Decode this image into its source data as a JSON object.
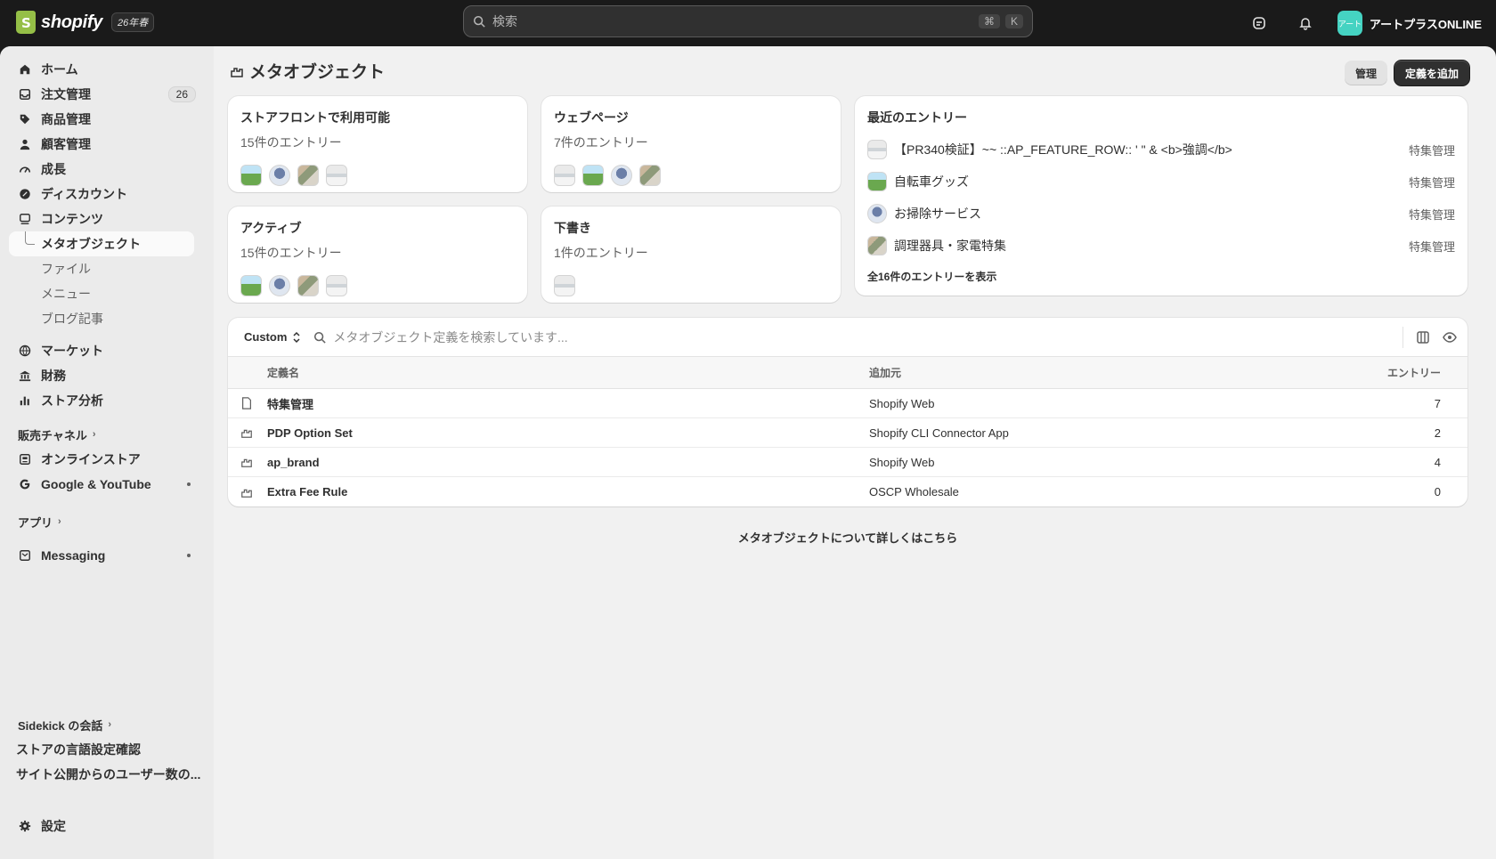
{
  "topbar": {
    "brand": "shopify",
    "edition_badge": "26年春",
    "search_placeholder": "検索",
    "shortcut_cmd": "⌘",
    "shortcut_key": "K",
    "store_avatar_text": "アート",
    "store_name": "アートプラスONLINE",
    "colors": {
      "background": "#1a1a1a",
      "avatar": "#45d3c2"
    }
  },
  "sidebar": {
    "items": [
      {
        "label": "ホーム",
        "icon": "home-icon"
      },
      {
        "label": "注文管理",
        "icon": "inbox-icon",
        "count": "26"
      },
      {
        "label": "商品管理",
        "icon": "tag-icon"
      },
      {
        "label": "顧客管理",
        "icon": "person-icon"
      },
      {
        "label": "成長",
        "icon": "gauge-icon"
      },
      {
        "label": "ディスカウント",
        "icon": "discount-icon"
      },
      {
        "label": "コンテンツ",
        "icon": "content-icon"
      }
    ],
    "content_sub": [
      {
        "label": "メタオブジェクト",
        "active": true
      },
      {
        "label": "ファイル"
      },
      {
        "label": "メニュー"
      },
      {
        "label": "ブログ記事"
      }
    ],
    "items2": [
      {
        "label": "マーケット",
        "icon": "globe-icon"
      },
      {
        "label": "財務",
        "icon": "bank-icon"
      },
      {
        "label": "ストア分析",
        "icon": "bar-chart-icon"
      }
    ],
    "sales_channels_label": "販売チャネル",
    "channels": [
      {
        "label": "オンラインストア",
        "icon": "store-icon"
      },
      {
        "label": "Google & YouTube",
        "icon": "google-icon"
      }
    ],
    "apps_label": "アプリ",
    "apps": [
      {
        "label": "Messaging",
        "icon": "messaging-icon"
      }
    ],
    "sidekick_label": "Sidekick の会話",
    "sidekick_items": [
      "ストアの言語設定確認",
      "サイト公開からのユーザー数の..."
    ],
    "settings_label": "設定"
  },
  "page": {
    "title": "メタオブジェクト",
    "manage_button": "管理",
    "add_definition_button": "定義を追加"
  },
  "cards": {
    "storefront": {
      "title": "ストアフロントで利用可能",
      "sub": "15件のエントリー"
    },
    "webpage": {
      "title": "ウェブページ",
      "sub": "7件のエントリー"
    },
    "active": {
      "title": "アクティブ",
      "sub": "15件のエントリー"
    },
    "draft": {
      "title": "下書き",
      "sub": "1件のエントリー"
    }
  },
  "recent": {
    "title": "最近のエントリー",
    "rows": [
      {
        "name": "【PR340検証】~~ ::AP_FEATURE_ROW:: ' \" & <b>強調</b>",
        "type": "特集管理"
      },
      {
        "name": "自転車グッズ",
        "type": "特集管理"
      },
      {
        "name": "お掃除サービス",
        "type": "特集管理"
      },
      {
        "name": "調理器具・家電特集",
        "type": "特集管理"
      }
    ],
    "view_all": "全16件のエントリーを表示"
  },
  "table": {
    "filter_label": "Custom",
    "search_placeholder": "メタオブジェクト定義を検索しています...",
    "headers": {
      "name": "定義名",
      "source": "追加元",
      "entries": "エントリー"
    },
    "rows": [
      {
        "name": "特集管理",
        "source": "Shopify Web",
        "entries": "7"
      },
      {
        "name": "PDP Option Set",
        "source": "Shopify CLI Connector App",
        "entries": "2"
      },
      {
        "name": "ap_brand",
        "source": "Shopify Web",
        "entries": "4"
      },
      {
        "name": "Extra Fee Rule",
        "source": "OSCP Wholesale",
        "entries": "0"
      }
    ]
  },
  "learn_more": "メタオブジェクトについて詳しくはこちら"
}
